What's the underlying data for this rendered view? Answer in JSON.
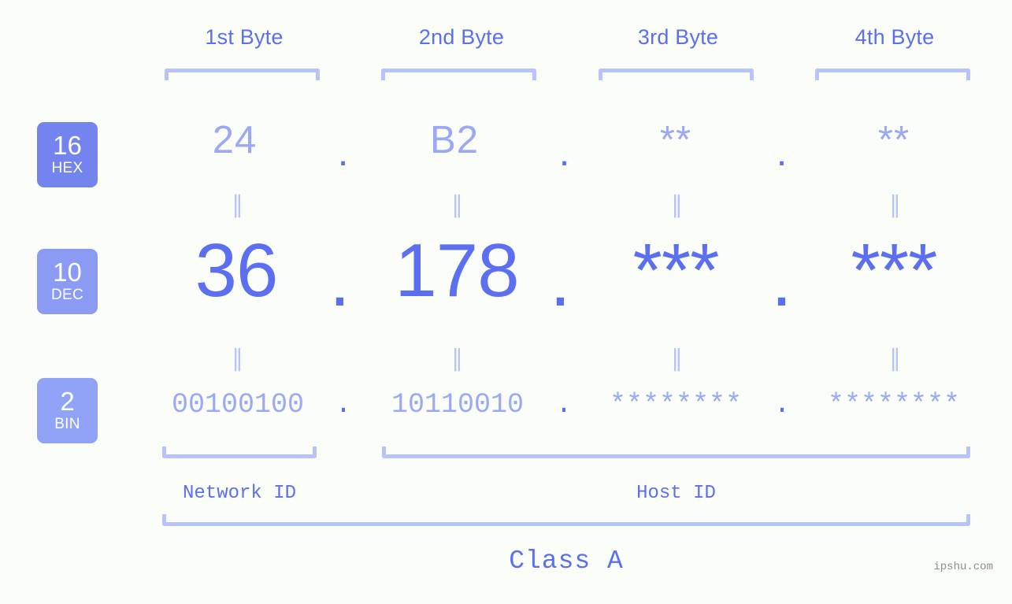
{
  "colors": {
    "background": "#fbfdf9",
    "accent_strong": "#5b6ff0",
    "accent_light": "#9aa8f5",
    "bracket": "#b9c3fb",
    "badge_hex": "#7384ee",
    "badge_dec": "#8b9bf3",
    "badge_bin": "#90a3f7",
    "watermark": "#8d8d8d"
  },
  "byte_headers": [
    {
      "label": "1st Byte"
    },
    {
      "label": "2nd Byte"
    },
    {
      "label": "3rd Byte"
    },
    {
      "label": "4th Byte"
    }
  ],
  "bases": [
    {
      "num": "16",
      "abbr": "HEX"
    },
    {
      "num": "10",
      "abbr": "DEC"
    },
    {
      "num": "2",
      "abbr": "BIN"
    }
  ],
  "rows": {
    "hex": {
      "values": [
        "24",
        "B2",
        "**",
        "**"
      ],
      "separator": "."
    },
    "dec": {
      "values": [
        "36",
        "178",
        "***",
        "***"
      ],
      "separator": "."
    },
    "bin": {
      "values": [
        "00100100",
        "10110010",
        "********",
        "********"
      ],
      "separator": "."
    }
  },
  "equals_glyph": "∥",
  "sections": {
    "network_id": "Network ID",
    "host_id": "Host ID",
    "class": "Class A"
  },
  "watermark": "ipshu.com"
}
